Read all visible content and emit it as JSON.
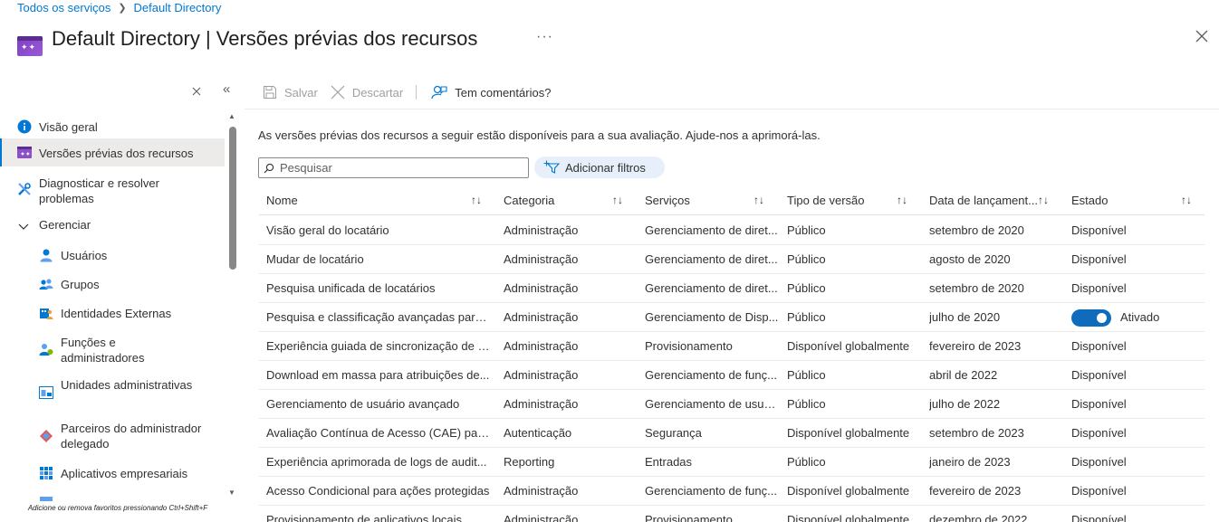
{
  "breadcrumb": {
    "item1": "Todos os serviços",
    "item2": "Default Directory",
    "separator": ">"
  },
  "page": {
    "title": "Default Directory | Versões prévias dos recursos",
    "more": "···"
  },
  "sidebar": {
    "items": [
      {
        "label": "Visão geral",
        "icon": "info-icon"
      },
      {
        "label": "Versões prévias dos recursos",
        "icon": "preview-features-icon"
      },
      {
        "label": "Diagnosticar e resolver problemas",
        "icon": "wrench-icon"
      },
      {
        "label": "Gerenciar",
        "icon": "chevron-down-icon"
      },
      {
        "label": "Usuários",
        "icon": "user-icon"
      },
      {
        "label": "Grupos",
        "icon": "groups-icon"
      },
      {
        "label": "Identidades Externas",
        "icon": "external-identities-icon"
      },
      {
        "label": "Funções e administradores",
        "icon": "roles-icon"
      },
      {
        "label": "Unidades administrativas",
        "icon": "admin-units-icon"
      },
      {
        "label": "Parceiros do administrador delegado",
        "icon": "partners-icon"
      },
      {
        "label": "Aplicativos empresariais",
        "icon": "enterprise-apps-icon"
      }
    ],
    "favorites_hint": "Adicione ou remova favoritos pressionando Ctrl+Shift+F"
  },
  "toolbar": {
    "save": "Salvar",
    "discard": "Descartar",
    "feedback": "Tem comentários?"
  },
  "description": "As versões prévias dos recursos a seguir estão disponíveis para a sua avaliação. Ajude-nos a aprimorá-las.",
  "search": {
    "placeholder": "Pesquisar"
  },
  "filter": {
    "label": "Adicionar filtros"
  },
  "table": {
    "columns": [
      "Nome",
      "Categoria",
      "Serviços",
      "Tipo de versão",
      "Data de lançament...",
      "Estado"
    ],
    "rows": [
      [
        "Visão geral do locatário",
        "Administração",
        "Gerenciamento de diret...",
        "Público",
        "setembro de 2020",
        "Disponível"
      ],
      [
        "Mudar de locatário",
        "Administração",
        "Gerenciamento de diret...",
        "Público",
        "agosto de 2020",
        "Disponível"
      ],
      [
        "Pesquisa unificada de locatários",
        "Administração",
        "Gerenciamento de diret...",
        "Público",
        "setembro de 2020",
        "Disponível"
      ],
      [
        "Pesquisa e classificação avançadas para ...",
        "Administração",
        "Gerenciamento de Disp...",
        "Público",
        "julho de 2020",
        "Ativado"
      ],
      [
        "Experiência guiada de sincronização de n...",
        "Administração",
        "Provisionamento",
        "Disponível globalmente",
        "fevereiro de 2023",
        "Disponível"
      ],
      [
        "Download em massa para atribuições de...",
        "Administração",
        "Gerenciamento de funç...",
        "Público",
        "abril de 2022",
        "Disponível"
      ],
      [
        "Gerenciamento de usuário avançado",
        "Administração",
        "Gerenciamento de usuá...",
        "Público",
        "julho de 2022",
        "Disponível"
      ],
      [
        "Avaliação Contínua de Acesso (CAE) para...",
        "Autenticação",
        "Segurança",
        "Disponível globalmente",
        "setembro de 2023",
        "Disponível"
      ],
      [
        "Experiência aprimorada de logs de audit...",
        "Reporting",
        "Entradas",
        "Público",
        "janeiro de 2023",
        "Disponível"
      ],
      [
        "Acesso Condicional para ações protegidas",
        "Administração",
        "Gerenciamento de funç...",
        "Disponível globalmente",
        "fevereiro de 2023",
        "Disponível"
      ],
      [
        "Provisionamento de aplicativos locais",
        "Administração",
        "Provisionamento",
        "Disponível globalmente",
        "dezembro de 2022",
        "Disponível"
      ]
    ]
  },
  "colors": {
    "accent": "#0078d4",
    "toggle_on": "#0f6cbd",
    "selected_bg": "#edebe9"
  }
}
